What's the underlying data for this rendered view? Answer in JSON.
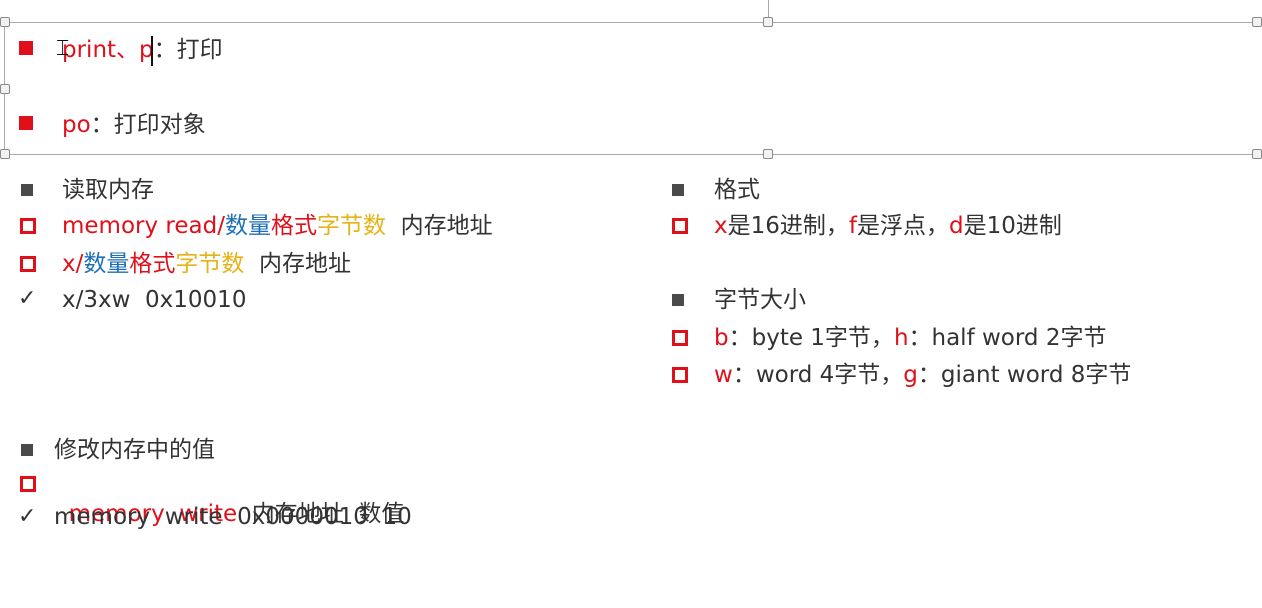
{
  "textbox": {
    "bullet1": {
      "cmd": "print、p",
      "sep": "：",
      "desc": "打印"
    },
    "bullet2": {
      "cmd": "po",
      "sep": "：",
      "desc": "打印对象"
    }
  },
  "left": {
    "read_heading": "读取内存",
    "read_line1": {
      "cmd": "memory read/",
      "count": "数量",
      "format": "格式",
      "bytes": "字节数",
      "addr": "内存地址"
    },
    "read_line2": {
      "cmd": "x/",
      "count": "数量",
      "format": "格式",
      "bytes": "字节数",
      "addr": "内存地址"
    },
    "read_example": "x/3xw  0x10010",
    "write_heading": "修改内存中的值",
    "write_line": {
      "cmd": "memory  write",
      "rest": "内存地址  数值"
    },
    "write_example": "memory  write  0x0000010  10"
  },
  "right": {
    "format_heading": "格式",
    "format_line": {
      "x": "x",
      "x_desc": "是16进制，",
      "f": "f",
      "f_desc": "是浮点，",
      "d": "d",
      "d_desc": "是10进制"
    },
    "size_heading": "字节大小",
    "size_line1": {
      "b": "b",
      "b_desc": "：byte 1字节，",
      "h": "h",
      "h_desc": "：half word 2字节"
    },
    "size_line2": {
      "w": "w",
      "w_desc": "：word 4字节，",
      "g": "g",
      "g_desc": "：giant word 8字节"
    }
  },
  "colors": {
    "red": "#e0101b",
    "blue": "#1f6fb6",
    "yellow": "#e5b317",
    "text": "#333333"
  }
}
